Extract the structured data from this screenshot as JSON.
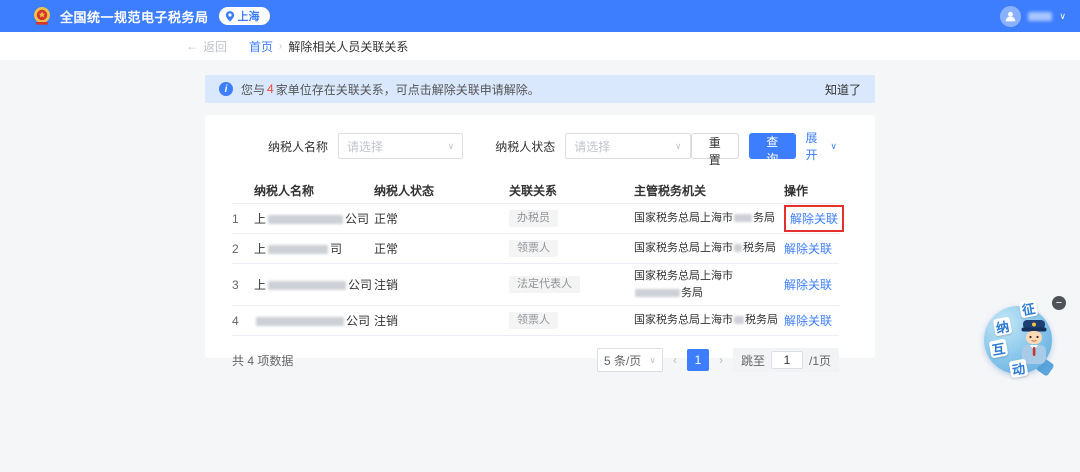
{
  "topbar": {
    "title": "全国统一规范电子税务局",
    "location": "上海",
    "user_menu_chevron": "∨"
  },
  "nav": {
    "back_icon": "←",
    "back_label": "返回",
    "breadcrumb_home": "首页",
    "breadcrumb_separator": "›",
    "breadcrumb_current": "解除相关人员关联关系"
  },
  "banner": {
    "info_icon": "i",
    "text_before_count": "您与",
    "count": "4",
    "text_after_count": "家单位存在关联关系，可点击解除关联申请解除。",
    "dismiss_label": "知道了"
  },
  "filters": {
    "name_label": "纳税人名称",
    "name_placeholder": "请选择",
    "status_label": "纳税人状态",
    "status_placeholder": "请选择",
    "select_chevron": "∨",
    "reset_label": "重置",
    "search_label": "查询",
    "expand_label": "展开",
    "expand_chevron": "∨"
  },
  "table": {
    "columns": {
      "name": "纳税人名称",
      "status": "纳税人状态",
      "relation": "关联关系",
      "authority": "主管税务机关",
      "action": "操作"
    },
    "rows": [
      {
        "index": "1",
        "name_prefix": "上",
        "name_redacted": true,
        "name_suffix": "公司",
        "status": "正常",
        "relation": "办税员",
        "authority_prefix": "国家税务总局上海市",
        "authority_redacted": true,
        "authority_suffix": "务局",
        "authority_wrap": false,
        "action": "解除关联",
        "highlighted": true
      },
      {
        "index": "2",
        "name_prefix": "上",
        "name_redacted": true,
        "name_suffix": "司",
        "status": "正常",
        "relation": "领票人",
        "authority_prefix": "国家税务总局上海市",
        "authority_redacted": true,
        "authority_suffix": "税务局",
        "authority_wrap": false,
        "action": "解除关联",
        "highlighted": false
      },
      {
        "index": "3",
        "name_prefix": "上",
        "name_redacted": true,
        "name_suffix": "公司",
        "status": "注销",
        "relation": "法定代表人",
        "authority_prefix": "国家税务总局上海市",
        "authority_redacted": true,
        "authority_suffix": "务局",
        "authority_wrap": true,
        "action": "解除关联",
        "highlighted": false
      },
      {
        "index": "4",
        "name_prefix": "",
        "name_redacted": true,
        "name_suffix": "公司",
        "status": "注销",
        "relation": "领票人",
        "authority_prefix": "国家税务总局上海市",
        "authority_redacted": true,
        "authority_suffix": "税务局",
        "authority_wrap": false,
        "action": "解除关联",
        "highlighted": false
      }
    ]
  },
  "footer": {
    "total_text": "共 4 项数据",
    "page_size": "5 条/页",
    "page_size_chevron": "∨",
    "prev_icon": "‹",
    "current_page": "1",
    "next_icon": "›",
    "jump_label": "跳至",
    "jump_value": "1",
    "jump_total": "/1页"
  },
  "assistant_widget": {
    "chars": [
      "征",
      "纳",
      "互",
      "动"
    ],
    "minimize_icon": "−"
  },
  "colors": {
    "primary_blue": "#3d7eff",
    "banner_bg": "#d9e8fc",
    "count_red": "#f5483b",
    "highlight_red": "#e5302f",
    "tag_bg": "#f4f4f5",
    "tag_text": "#909399"
  }
}
